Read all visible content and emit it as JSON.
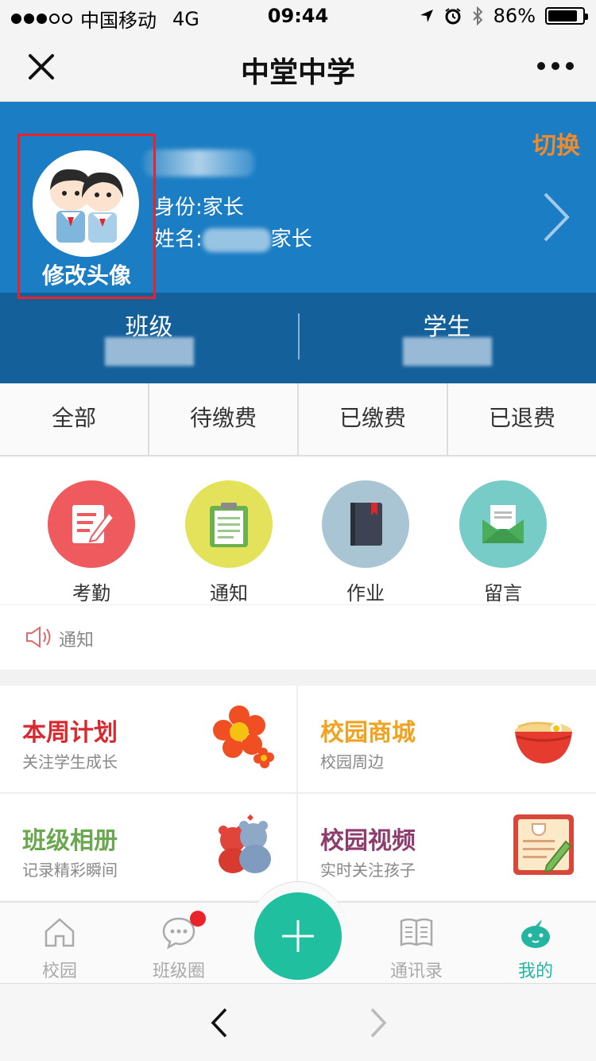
{
  "status_bar": {
    "carrier": "中国移动",
    "network": "4G",
    "time": "09:44",
    "battery": "86%",
    "battery_level": 0.86
  },
  "nav": {
    "title": "中堂中学"
  },
  "profile": {
    "avatar_label": "修改头像",
    "switch_label": "切换",
    "identity": "身份:家长",
    "name_prefix": "姓名:",
    "name_suffix": "家长"
  },
  "stats": [
    {
      "label": "班级"
    },
    {
      "label": "学生"
    }
  ],
  "tabs": [
    {
      "label": "全部"
    },
    {
      "label": "待缴费"
    },
    {
      "label": "已缴费"
    },
    {
      "label": "已退费"
    }
  ],
  "grid": [
    {
      "label": "考勤",
      "icon": "attendance-icon",
      "color": "#ef5a5f"
    },
    {
      "label": "通知",
      "icon": "notice-clipboard-icon",
      "color": "#e3e25a"
    },
    {
      "label": "作业",
      "icon": "homework-book-icon",
      "color": "#a9c4d2"
    },
    {
      "label": "留言",
      "icon": "message-envelope-icon",
      "color": "#78ccc8"
    }
  ],
  "notice": {
    "label": "通知"
  },
  "cards": [
    {
      "title": "本周计划",
      "subtitle": "关注学生成长",
      "color": "#d9292f",
      "icon": "flower-icon"
    },
    {
      "title": "校园商城",
      "subtitle": "校园周边",
      "color": "#f0a320",
      "icon": "noodle-bowl-icon"
    },
    {
      "title": "班级相册",
      "subtitle": "记录精彩瞬间",
      "color": "#6aa84f",
      "icon": "bears-icon"
    },
    {
      "title": "校园视频",
      "subtitle": "实时关注孩子",
      "color": "#8e3b6e",
      "icon": "notebook-pencil-icon"
    }
  ],
  "tabbar": [
    {
      "label": "校园",
      "icon": "home-icon"
    },
    {
      "label": "班级圈",
      "icon": "chat-bubble-icon"
    },
    {
      "label": "通讯录",
      "icon": "contacts-book-icon"
    },
    {
      "label": "我的",
      "icon": "profile-mascot-icon"
    }
  ],
  "colors": {
    "header_blue": "#1b7dc4",
    "header_dark": "#14609b",
    "accent_green": "#1fbf9f",
    "switch_orange": "#f08a2c"
  }
}
